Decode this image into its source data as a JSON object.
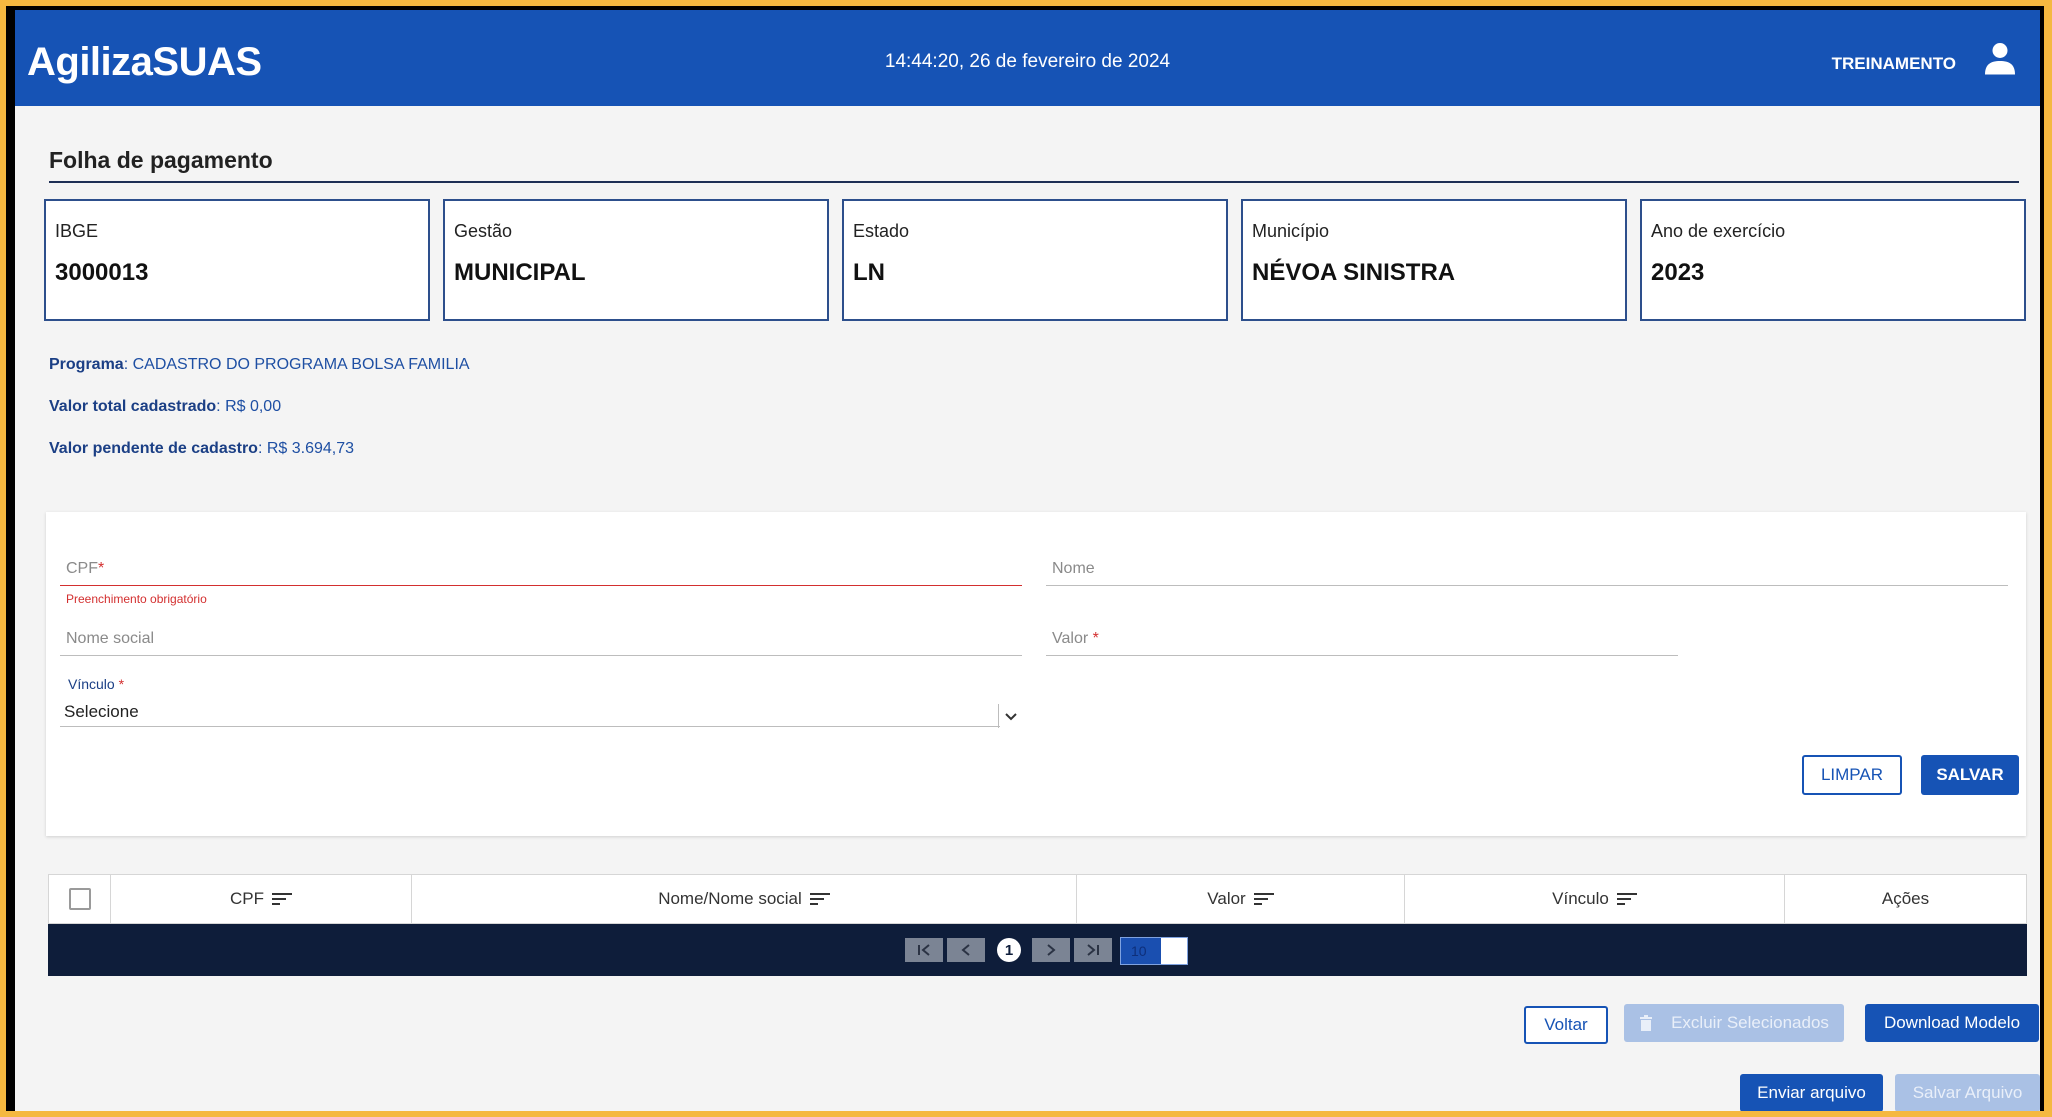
{
  "header": {
    "brand": "AgilizaSUAS",
    "datetime": "14:44:20, 26 de fevereiro de 2024",
    "user": "TREINAMENTO",
    "user_icon": "person-icon"
  },
  "page": {
    "title": "Folha de pagamento"
  },
  "cards": [
    {
      "label": "IBGE",
      "value": "3000013"
    },
    {
      "label": "Gestão",
      "value": "MUNICIPAL"
    },
    {
      "label": "Estado",
      "value": "LN"
    },
    {
      "label": "Município",
      "value": "NÉVOA SINISTRA"
    },
    {
      "label": "Ano de exercício",
      "value": "2023"
    }
  ],
  "info": {
    "programa_label": "Programa",
    "programa_value": ": CADASTRO DO PROGRAMA BOLSA FAMILIA",
    "total_label": "Valor total cadastrado",
    "total_value": ": R$ 0,00",
    "pendente_label": "Valor pendente de cadastro",
    "pendente_value": ": R$ 3.694,73"
  },
  "form": {
    "cpf_label": "CPF",
    "cpf_error": "Preenchimento obrigatório",
    "nome_label": "Nome",
    "nome_social_label": "Nome social",
    "valor_label": "Valor ",
    "vinculo_label": "Vínculo ",
    "vinculo_selected": "Selecione",
    "required_mark": "*",
    "limpar": "LIMPAR",
    "salvar": "SALVAR"
  },
  "table": {
    "columns": [
      "CPF",
      "Nome/Nome social",
      "Valor",
      "Vínculo",
      "Ações"
    ]
  },
  "pager": {
    "current_page": "1",
    "page_size": "10"
  },
  "actions": {
    "voltar": "Voltar",
    "excluir": "Excluir Selecionados",
    "download": "Download Modelo",
    "enviar": "Enviar arquivo",
    "salvar_arquivo": "Salvar Arquivo"
  },
  "colors": {
    "primary": "#1653b5",
    "error": "#d32f2f",
    "pager_bg": "#0e1d3a",
    "frame": "#f5b840"
  }
}
